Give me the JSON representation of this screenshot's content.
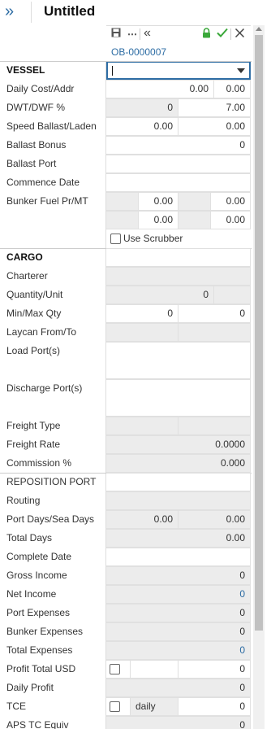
{
  "header": {
    "title": "Untitled",
    "expand_icon": "double-chevron-right"
  },
  "toolbar": {
    "save_icon": "save",
    "more_icon": "more",
    "collapse_icon": "double-chevron-left",
    "lock_icon": "lock",
    "confirm_icon": "check",
    "close_icon": "close"
  },
  "record_id": "OB-0000007",
  "vessel": {
    "section_label": "VESSEL",
    "vessel_value": "",
    "daily_cost_label": "Daily Cost/Addr",
    "daily_cost": "0.00",
    "daily_addr": "0.00",
    "dwt_label": "DWT/DWF %",
    "dwt": "0",
    "dwf": "7.00",
    "speed_label": "Speed Ballast/Laden",
    "speed_ballast": "0.00",
    "speed_laden": "0.00",
    "ballast_bonus_label": "Ballast Bonus",
    "ballast_bonus": "0",
    "ballast_port_label": "Ballast Port",
    "commence_label": "Commence Date",
    "bunker_label": "Bunker Fuel Pr/MT",
    "bunker_r1c1": "0.00",
    "bunker_r1c2": "0.00",
    "bunker_r2c1": "0.00",
    "bunker_r2c2": "0.00",
    "scrubber_label": "Use Scrubber"
  },
  "cargo": {
    "section_label": "CARGO",
    "charterer_label": "Charterer",
    "quantity_label": "Quantity/Unit",
    "quantity": "0",
    "minmax_label": "Min/Max Qty",
    "min_qty": "0",
    "max_qty": "0",
    "laycan_label": "Laycan From/To",
    "load_label": "Load Port(s)",
    "discharge_label": "Discharge Port(s)",
    "freight_type_label": "Freight Type",
    "freight_rate_label": "Freight Rate",
    "freight_rate": "0.0000",
    "commission_label": "Commission %",
    "commission": "0.000"
  },
  "reposition": {
    "section_label": "REPOSITION PORT",
    "routing_label": "Routing",
    "port_sea_label": "Port Days/Sea Days",
    "port_days": "0.00",
    "sea_days": "0.00",
    "total_days_label": "Total Days",
    "total_days": "0.00",
    "complete_label": "Complete Date",
    "gross_label": "Gross Income",
    "gross": "0",
    "net_label": "Net Income",
    "net": "0",
    "port_exp_label": "Port Expenses",
    "port_exp": "0",
    "bunker_exp_label": "Bunker Expenses",
    "bunker_exp": "0",
    "total_exp_label": "Total Expenses",
    "total_exp": "0",
    "profit_label": "Profit Total USD",
    "profit": "0",
    "daily_profit_label": "Daily Profit",
    "daily_profit": "0",
    "tce_label": "TCE",
    "tce_period": "daily",
    "tce": "0",
    "aps_label": "APS TC Equiv",
    "aps": "0"
  },
  "colors": {
    "accent": "#2e6da4",
    "readonly": "#ececec",
    "lock": "#3aa83a"
  }
}
